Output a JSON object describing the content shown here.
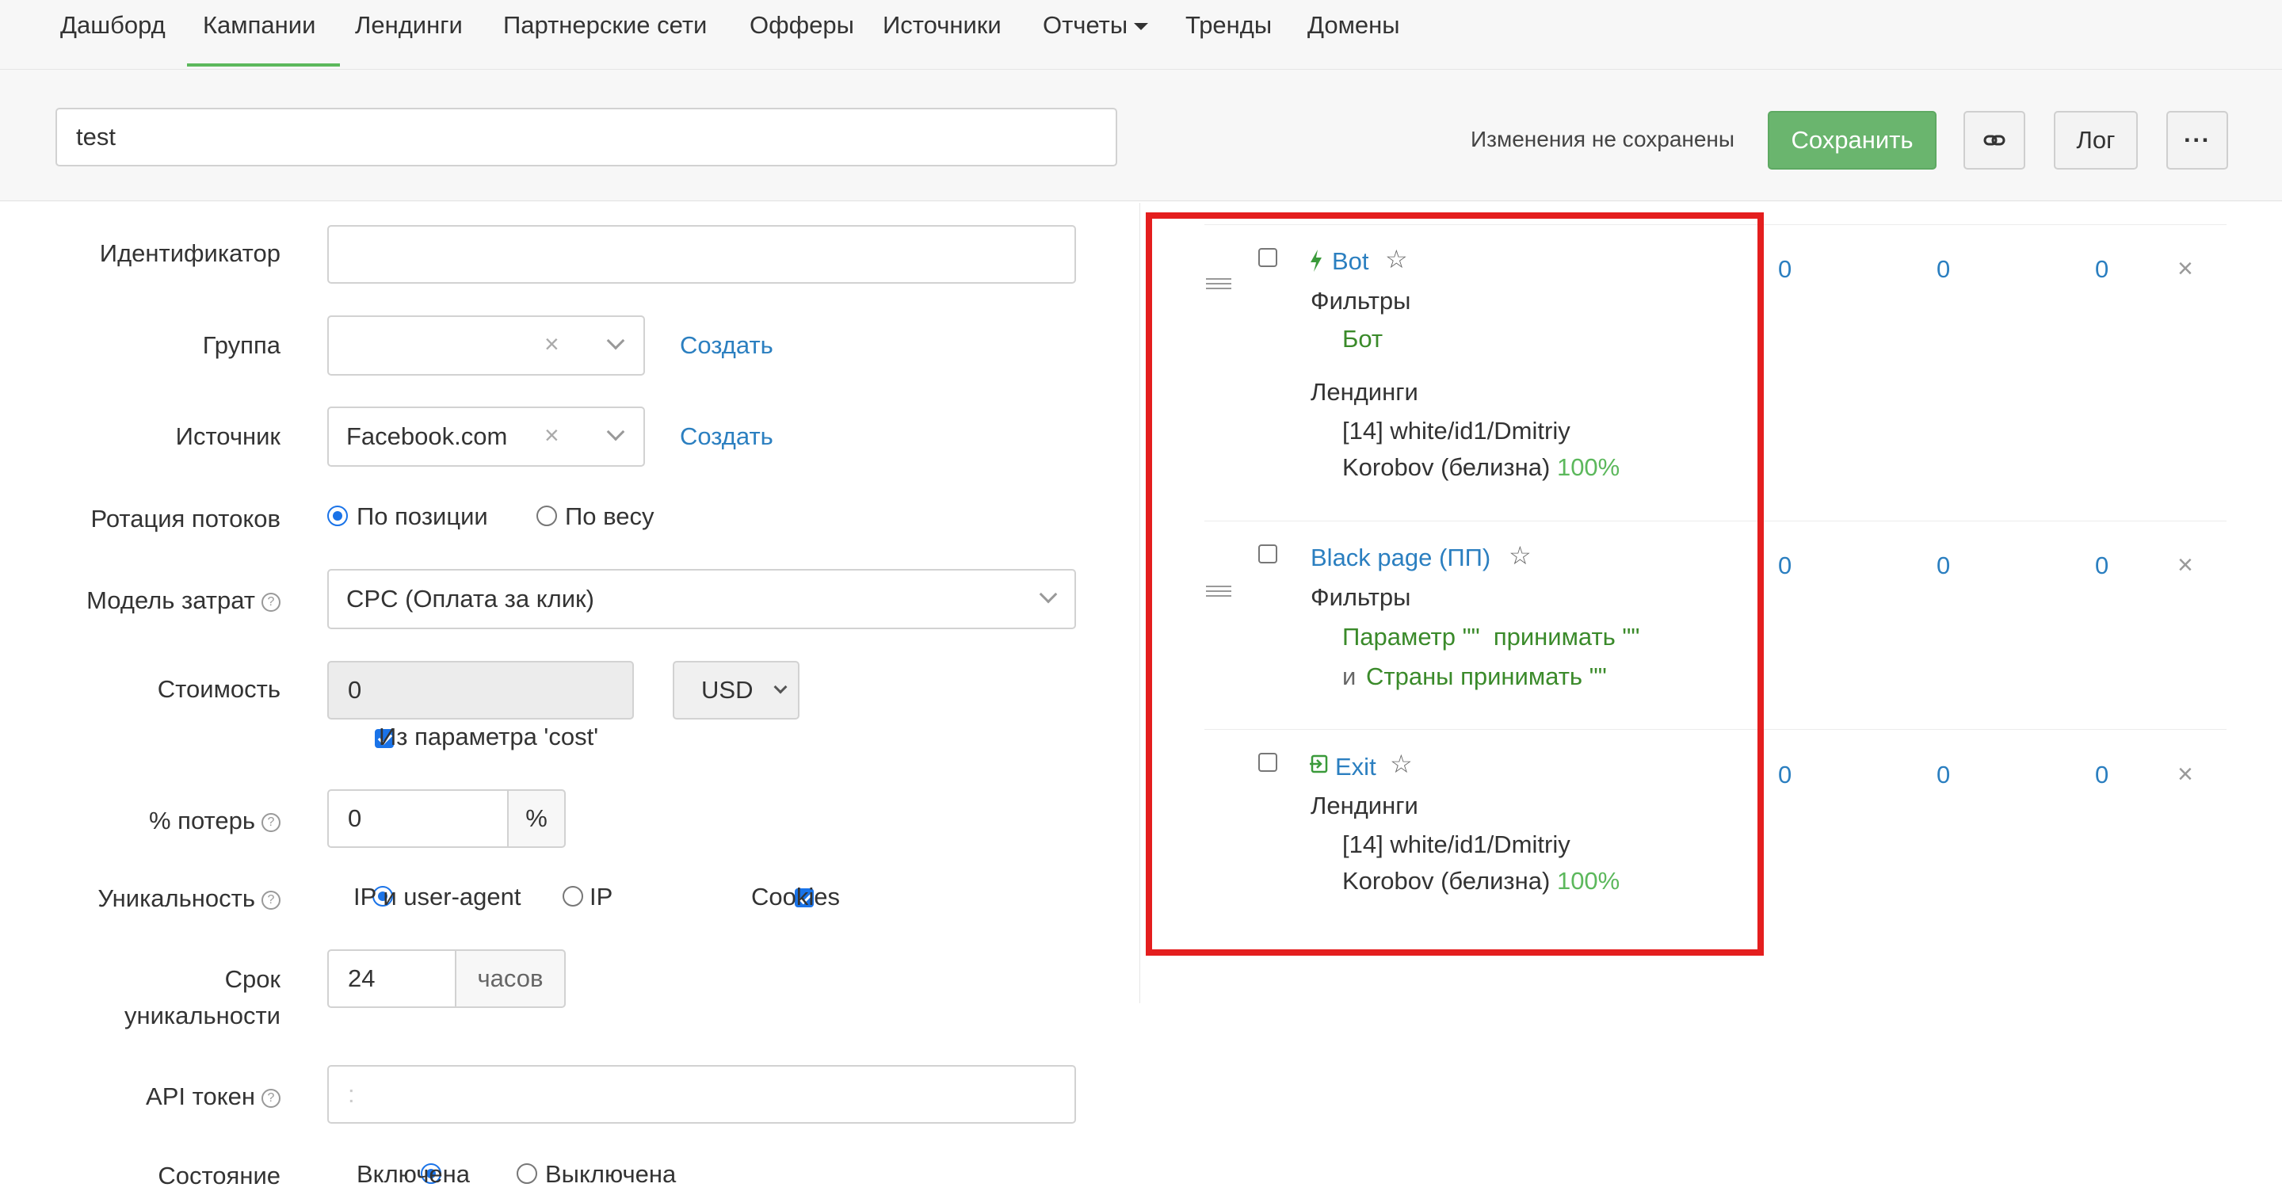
{
  "nav": {
    "items": [
      "Дашборд",
      "Кампании",
      "Лендинги",
      "Партнерские сети",
      "Офферы",
      "Источники",
      "Отчеты",
      "Тренды",
      "Домены"
    ],
    "active": "Кампании"
  },
  "header": {
    "campaign_name": "test",
    "unsaved_text": "Изменения не сохранены",
    "save_label": "Сохранить",
    "log_label": "Лог",
    "more_label": "···"
  },
  "form": {
    "identifier_label": "Идентификатор",
    "identifier_value": "",
    "group_label": "Группа",
    "group_value": "",
    "create_label": "Создать",
    "source_label": "Источник",
    "source_value": "Facebook.com",
    "rotation_label": "Ротация потоков",
    "rotation_options": [
      "По позиции",
      "По весу"
    ],
    "rotation_selected": "По позиции",
    "cost_model_label": "Модель затрат",
    "cost_model_value": "CPC (Оплата за клик)",
    "cost_label": "Стоимость",
    "cost_value": "0",
    "currency_value": "USD",
    "cost_param_label": "Из параметра 'cost'",
    "cost_param_checked": true,
    "loss_label": "% потерь",
    "loss_value": "0",
    "loss_unit": "%",
    "uniqueness_label": "Уникальность",
    "uniqueness_options": [
      "IP и user-agent",
      "IP"
    ],
    "uniqueness_selected": "IP и user-agent",
    "cookies_label": "Cookies",
    "cookies_checked": true,
    "uniq_term_label_1": "Срок",
    "uniq_term_label_2": "уникальности",
    "uniq_term_value": "24",
    "uniq_term_unit": "часов",
    "api_token_label": "API токен",
    "api_token_value": ":",
    "state_label": "Состояние",
    "state_options": [
      "Включена",
      "Выключена"
    ],
    "state_selected": "Включена"
  },
  "flows": [
    {
      "name": "Bot",
      "icon": "lightning-icon",
      "filters_label": "Фильтры",
      "filter_1": "Бот",
      "landings_label": "Лендинги",
      "landing_line_1": "[14] white/id1/Dmitriy",
      "landing_line_2": "Korobov (белизна)",
      "landing_pct": "100%",
      "stats": [
        "0",
        "0",
        "0"
      ]
    },
    {
      "name": "Black page (ПП)",
      "filters_label": "Фильтры",
      "filter_1": "Параметр \"\"  принимать \"\"",
      "filter_2_and": "и",
      "filter_2": "Страны принимать \"\"",
      "stats": [
        "0",
        "0",
        "0"
      ]
    },
    {
      "name": "Exit",
      "icon": "exit-icon",
      "landings_label": "Лендинги",
      "landing_line_1": "[14] white/id1/Dmitriy",
      "landing_line_2": "Korobov (белизна)",
      "landing_pct": "100%",
      "stats": [
        "0",
        "0",
        "0"
      ]
    }
  ],
  "colors": {
    "accent_green": "#5cb85c",
    "link_blue": "#2b7fc0",
    "highlight_red": "#e41e1e"
  }
}
